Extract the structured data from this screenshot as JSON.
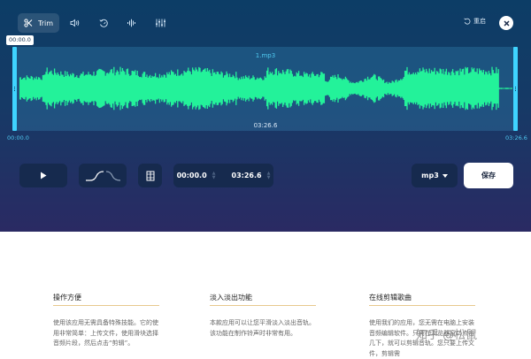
{
  "toolbar": {
    "trim_label": "Trim",
    "tools": [
      {
        "name": "trim",
        "icon": "scissors-icon"
      },
      {
        "name": "volume",
        "icon": "volume-icon"
      },
      {
        "name": "speed",
        "icon": "speed-icon"
      },
      {
        "name": "equalizer",
        "icon": "waveform-icon"
      },
      {
        "name": "mixer",
        "icon": "sliders-icon"
      }
    ]
  },
  "header": {
    "reset_label": "重启"
  },
  "editor": {
    "file_name": "1.mp3",
    "current_time": "00:00.0",
    "start_label": "00:00.0",
    "end_label": "03:26.6",
    "center_duration": "03:26.6"
  },
  "controls": {
    "start_time": "00:00.0",
    "end_time": "03:26.6",
    "format": "mp3",
    "save_label": "保存"
  },
  "features": [
    {
      "title": "操作方便",
      "body": "使用该应用无需具备特殊技能。它的使用非常简单：上传文件，使用滑块选择音频片段，然后点击“剪辑”。"
    },
    {
      "title": "淡入淡出功能",
      "body": "本款应用可以让您平滑淡入淡出音轨。该功能在制作铃声时非常有用。"
    },
    {
      "title": "在线剪辑歌曲",
      "body": "使用我们的应用，您无需在电脑上安装音频编辑软件。只需在浏览器窗口点击几下，就可以剪辑音轨。您只要上传文件，剪辑需"
    }
  ],
  "watermark": "知乎 @松鼠",
  "colors": {
    "accent": "#3fd4ff",
    "waveform": "#23f29a",
    "background_top": "#0c3d66",
    "background_bottom": "#2a2a63"
  }
}
